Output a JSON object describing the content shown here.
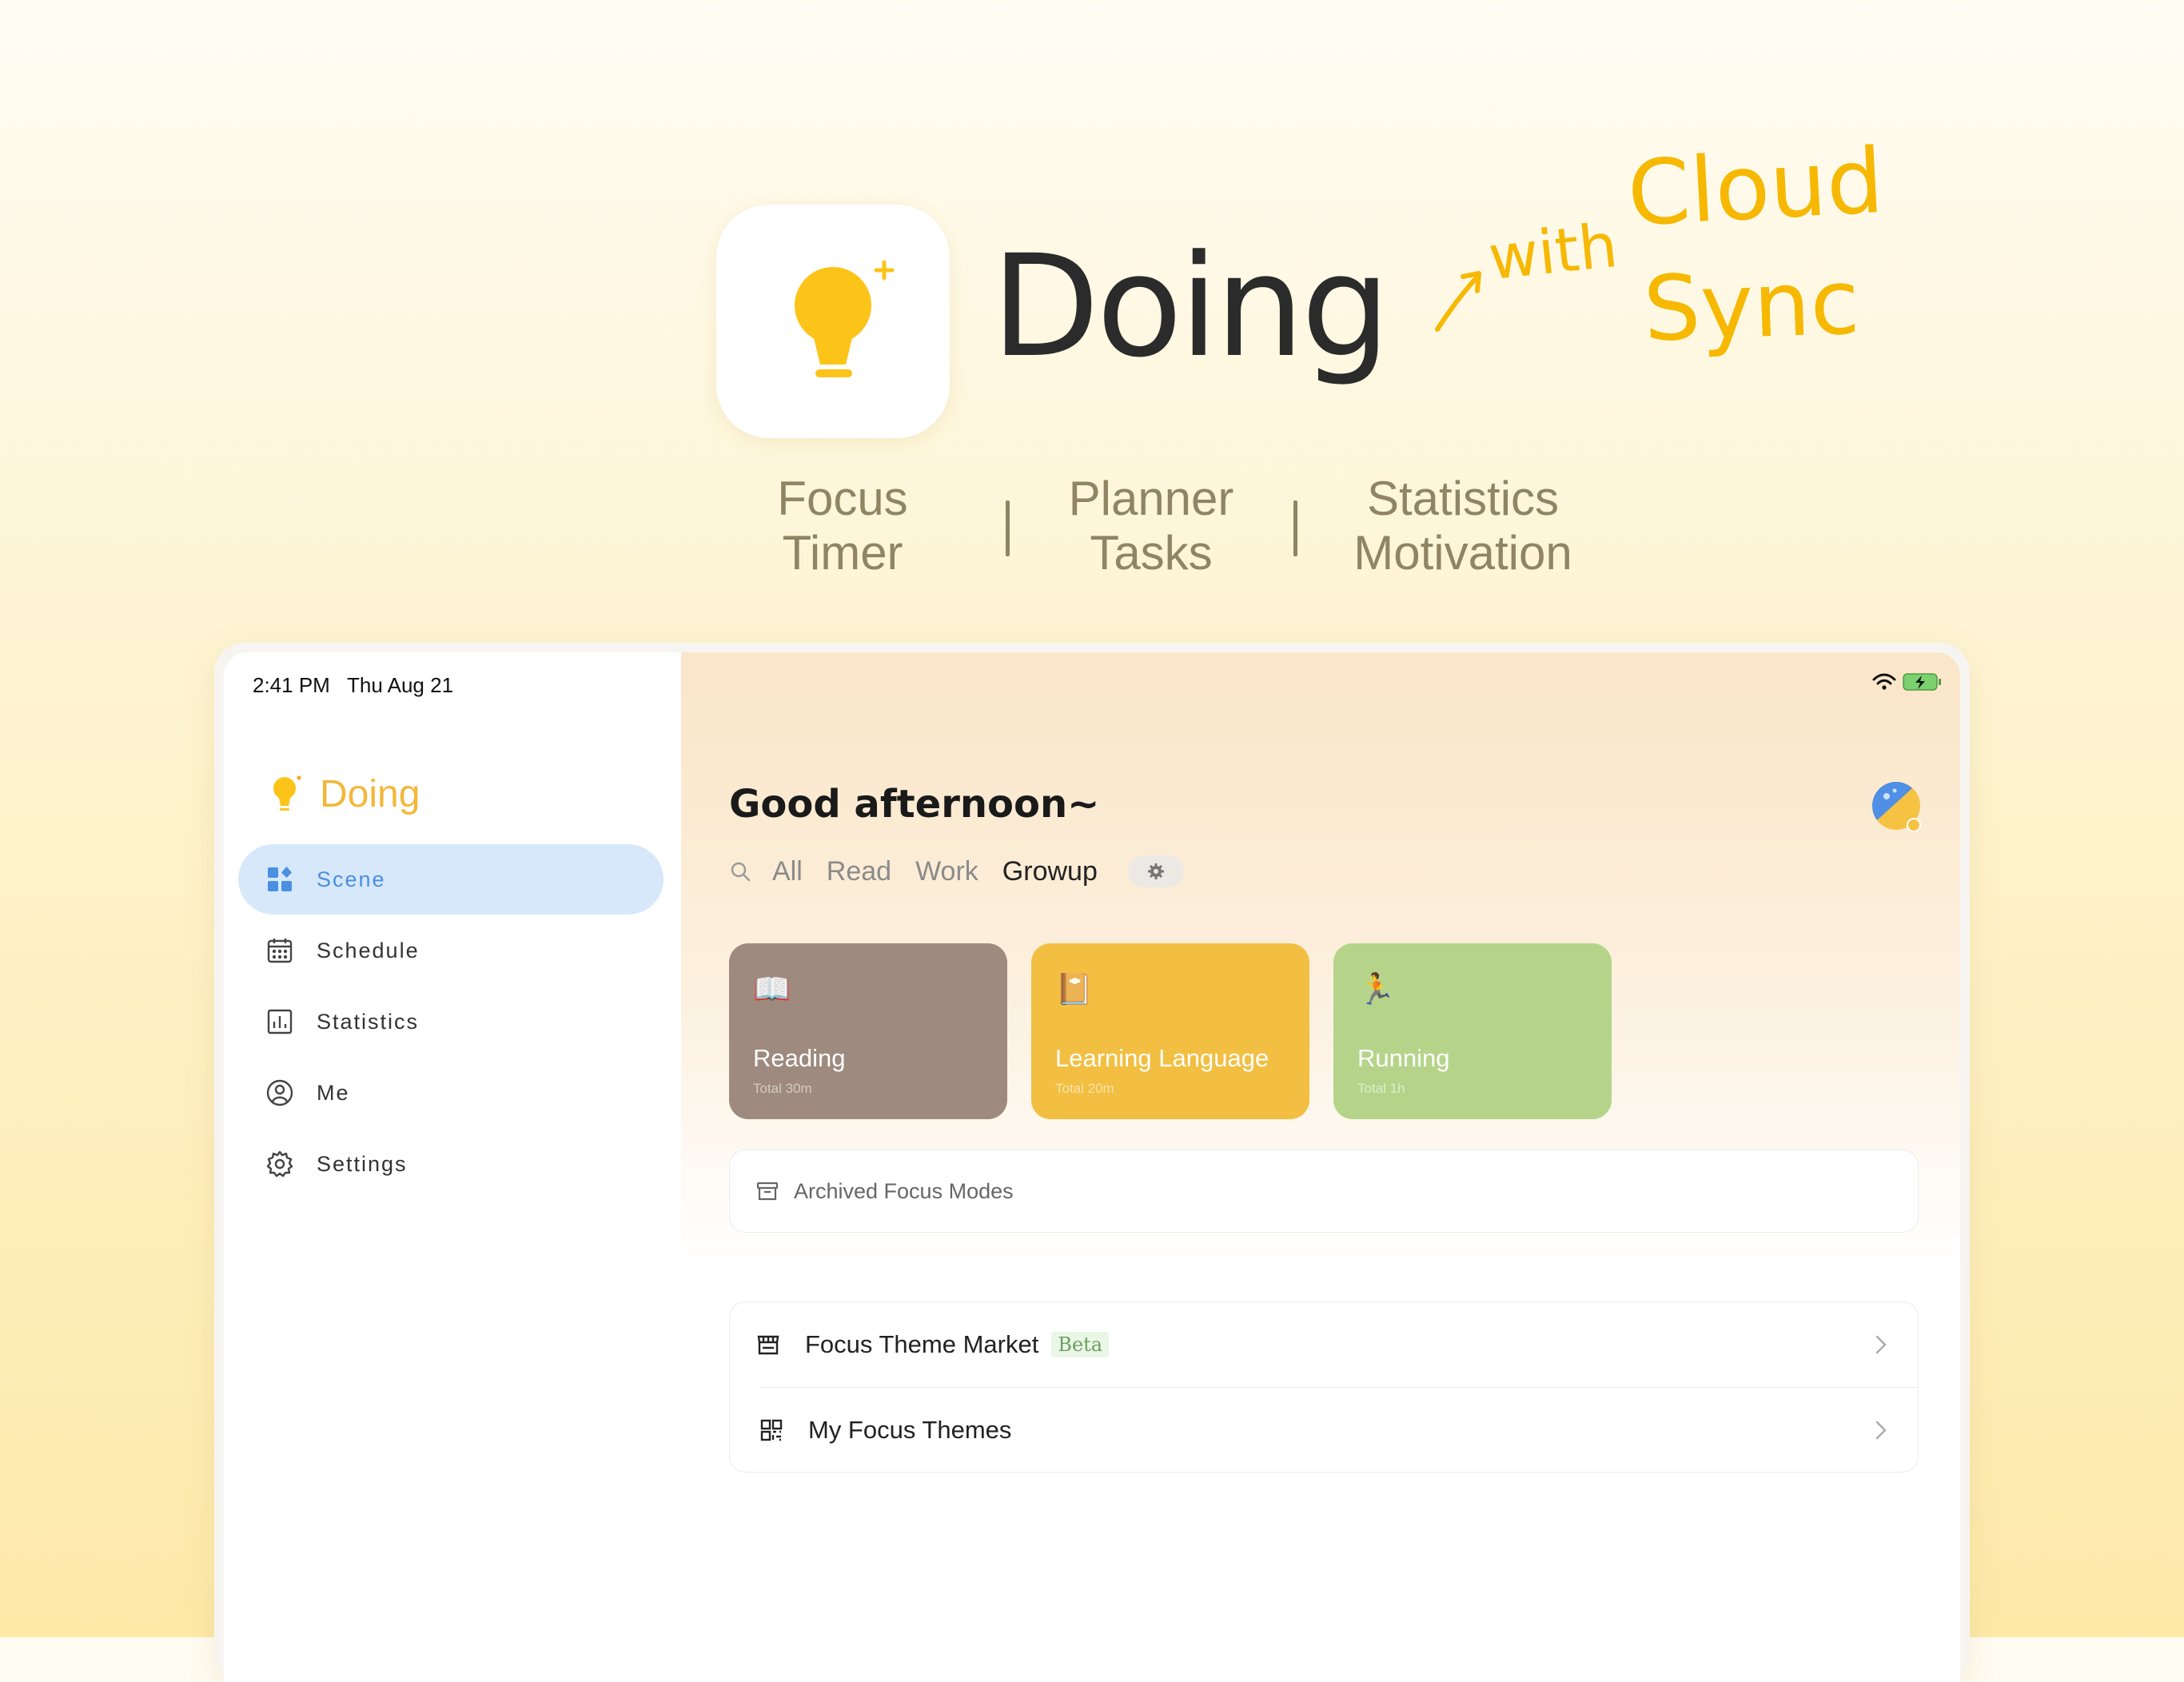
{
  "promo": {
    "app_name": "Doing",
    "handwriting": {
      "with": "with",
      "cloud": "Cloud",
      "sync": "Sync"
    },
    "features": [
      {
        "line1": "Focus",
        "line2": "Timer"
      },
      {
        "line1": "Planner",
        "line2": "Tasks"
      },
      {
        "line1": "Statistics",
        "line2": "Motivation"
      }
    ],
    "colors": {
      "accent": "#F6B800",
      "bulb": "#FCC419",
      "muted_text": "#8F8464"
    }
  },
  "status_bar": {
    "time": "2:41 PM",
    "date": "Thu Aug 21",
    "icons": [
      "wifi-icon",
      "battery-charging-icon"
    ]
  },
  "sidebar": {
    "brand": "Doing",
    "items": [
      {
        "label": "Scene",
        "icon": "grid-icon",
        "active": true
      },
      {
        "label": "Schedule",
        "icon": "calendar-icon",
        "active": false
      },
      {
        "label": "Statistics",
        "icon": "bar-chart-icon",
        "active": false
      },
      {
        "label": "Me",
        "icon": "user-circle-icon",
        "active": false
      },
      {
        "label": "Settings",
        "icon": "gear-icon",
        "active": false
      }
    ]
  },
  "main": {
    "greeting": "Good afternoon~",
    "tabs": [
      {
        "label": "All",
        "active": false
      },
      {
        "label": "Read",
        "active": false
      },
      {
        "label": "Work",
        "active": false
      },
      {
        "label": "Growup",
        "active": true
      }
    ],
    "cards": [
      {
        "title": "Reading",
        "subtitle": "Total 30m",
        "emoji": "📖",
        "color": "#9E8A7E"
      },
      {
        "title": "Learning Language",
        "subtitle": "Total 20m",
        "emoji": "📔",
        "color": "#F2BF42"
      },
      {
        "title": "Running",
        "subtitle": "Total 1h",
        "emoji": "🏃",
        "color": "#B5D48A"
      }
    ],
    "archived_label": "Archived Focus Modes",
    "list": [
      {
        "label": "Focus Theme Market",
        "badge": "Beta"
      },
      {
        "label": "My Focus Themes"
      }
    ]
  }
}
